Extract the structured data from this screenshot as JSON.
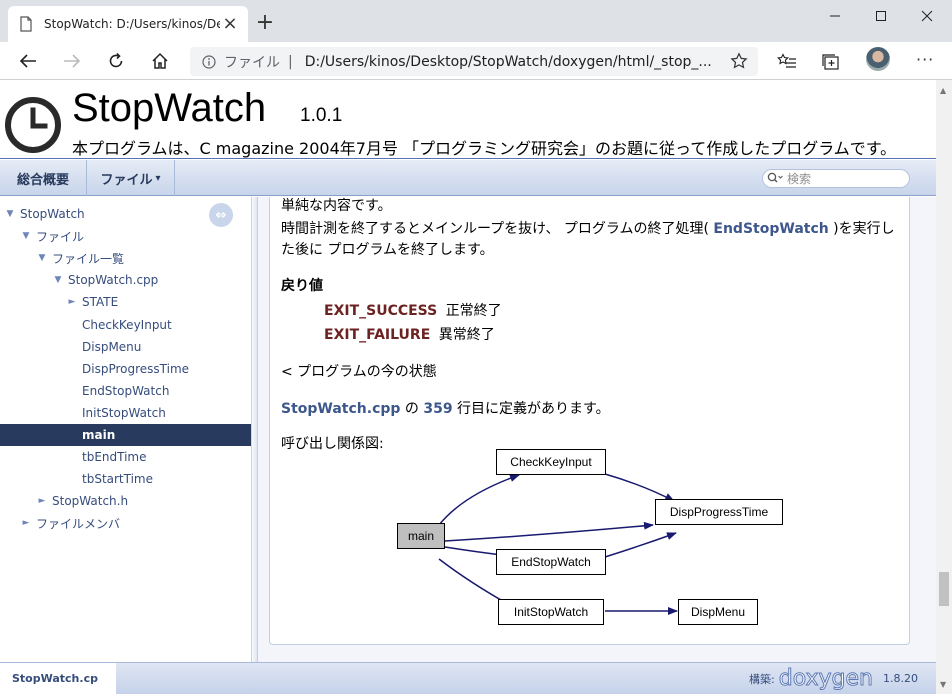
{
  "browser": {
    "tab_title": "StopWatch: D:/Users/kinos/Deskt",
    "tab_close": "×",
    "new_tab": "+",
    "url_scheme": "ファイル",
    "url_separator": "|",
    "url": "D:/Users/kinos/Desktop/StopWatch/doxygen/html/_stop_...",
    "more": "···"
  },
  "header": {
    "project_name": "StopWatch",
    "project_number": "1.0.1",
    "project_brief": "本プログラムは、C magazine 2004年7月号 「プログラミング研究会」のお題に従って作成したプログラムです。"
  },
  "navbar": {
    "tabs": [
      "総合概要",
      "ファイル"
    ],
    "file_dropdown": "▾",
    "search_placeholder": "検索"
  },
  "tree": [
    {
      "label": "StopWatch",
      "arrow": "▼"
    },
    {
      "label": "ファイル",
      "arrow": "▼"
    },
    {
      "label": "ファイル一覧",
      "arrow": "▼"
    },
    {
      "label": "StopWatch.cpp",
      "arrow": "▼"
    },
    {
      "label": "STATE",
      "arrow": "►"
    },
    {
      "label": "CheckKeyInput",
      "arrow": ""
    },
    {
      "label": "DispMenu",
      "arrow": ""
    },
    {
      "label": "DispProgressTime",
      "arrow": ""
    },
    {
      "label": "EndStopWatch",
      "arrow": ""
    },
    {
      "label": "InitStopWatch",
      "arrow": ""
    },
    {
      "label": "main",
      "arrow": ""
    },
    {
      "label": "tbEndTime",
      "arrow": ""
    },
    {
      "label": "tbStartTime",
      "arrow": ""
    },
    {
      "label": "StopWatch.h",
      "arrow": "►"
    },
    {
      "label": "ファイルメンバ",
      "arrow": "►"
    }
  ],
  "doc": {
    "line1": "単純な内容です。",
    "line2_pre": "時間計測を終了するとメインループを抜け、 プログラムの終了処理( ",
    "line2_link": "EndStopWatch",
    "line2_post": " )を実行し",
    "line3": "た後に プログラムを終了します。",
    "retval_heading": "戻り値",
    "retvals": [
      {
        "name": "EXIT_SUCCESS",
        "desc": "正常終了"
      },
      {
        "name": "EXIT_FAILURE",
        "desc": "異常終了"
      }
    ],
    "state_note": "< プログラムの今の状態",
    "def_file": "StopWatch.cpp",
    "def_mid": " の ",
    "def_line": "359",
    "def_post": " 行目に定義があります。",
    "callgraph_label": "呼び出し関係図:"
  },
  "callgraph": {
    "nodes": [
      "main",
      "CheckKeyInput",
      "DispProgressTime",
      "EndStopWatch",
      "InitStopWatch",
      "DispMenu"
    ]
  },
  "footer": {
    "breadcrumb": "StopWatch.cpp",
    "generated_by": "構築:",
    "doxygen": "doxygen",
    "version": "1.8.20"
  },
  "colors": {
    "nav_dark": "#283a5d",
    "link": "#3d578c",
    "retval": "#6d2222"
  }
}
